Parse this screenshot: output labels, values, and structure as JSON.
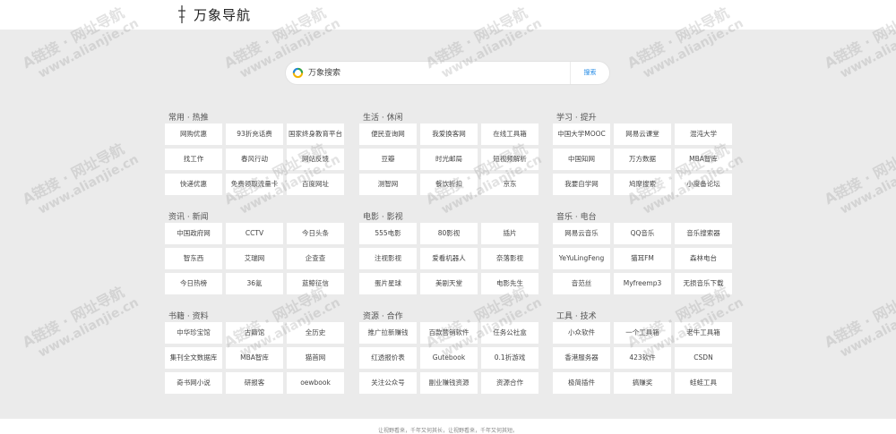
{
  "header": {
    "title": "万象导航",
    "logo_icon": "sword-icon"
  },
  "search": {
    "placeholder": "万象搜索",
    "button_label": "搜索",
    "icon": "search-logo-icon"
  },
  "sections": [
    {
      "title": "常用 · 热推",
      "items": [
        "网购优惠",
        "93折充话费",
        "国家终身教育平台",
        "找工作",
        "春风行动",
        "网站反馈",
        "快递优惠",
        "免费领取流量卡",
        "百度网址"
      ]
    },
    {
      "title": "生活 · 休闲",
      "items": [
        "便民查询网",
        "我爱换客网",
        "在线工具箱",
        "豆瓣",
        "时光邮局",
        "短视频解析",
        "测智网",
        "餐饮折扣",
        "京东"
      ]
    },
    {
      "title": "学习 · 提升",
      "items": [
        "中国大学MOOC",
        "网易云课堂",
        "混沌大学",
        "中国知网",
        "万方数据",
        "MBA智库",
        "我要自学网",
        "鸠摩搜索",
        "小度备论坛"
      ]
    },
    {
      "title": "资讯 · 新闻",
      "items": [
        "中国政府网",
        "CCTV",
        "今日头条",
        "智东西",
        "艾瑞网",
        "企查查",
        "今日热榜",
        "36氪",
        "蓝鲸征信"
      ]
    },
    {
      "title": "电影 · 影视",
      "items": [
        "555电影",
        "80影视",
        "插片",
        "注视影视",
        "爱看机器人",
        "奈落影视",
        "蛋片星球",
        "美剧天堂",
        "电影先生"
      ]
    },
    {
      "title": "音乐 · 电台",
      "items": [
        "网易云音乐",
        "QQ音乐",
        "音乐搜索器",
        "YeYuLingFeng",
        "猫耳FM",
        "森林电台",
        "音范丝",
        "Myfreemp3",
        "无损音乐下载"
      ]
    },
    {
      "title": "书籍 · 资料",
      "items": [
        "中华珍宝馆",
        "古籍馆",
        "全历史",
        "集刊全文数据库",
        "MBA智库",
        "猫首网",
        "奇书网小说",
        "研报客",
        "oewbook"
      ]
    },
    {
      "title": "资源 · 合作",
      "items": [
        "推广拉新赚钱",
        "百款营销软件",
        "任务公社盒",
        "红透报价表",
        "Gutebook",
        "0.1折游戏",
        "关注公众号",
        "副业赚钱资源",
        "资源合作"
      ]
    },
    {
      "title": "工具 · 技术",
      "items": [
        "小众软件",
        "一个工具箱",
        "老牛工具箱",
        "香港服务器",
        "423软件",
        "CSDN",
        "极简插件",
        "搞赚奖",
        "蛙蛙工具"
      ]
    }
  ],
  "footer": {
    "text": "让视野看来，千年又何其长，让视野看来，千年又何其短。"
  },
  "watermark": {
    "line1": "A链接 · 网址导航",
    "line2": "www.alianjie.cn"
  }
}
